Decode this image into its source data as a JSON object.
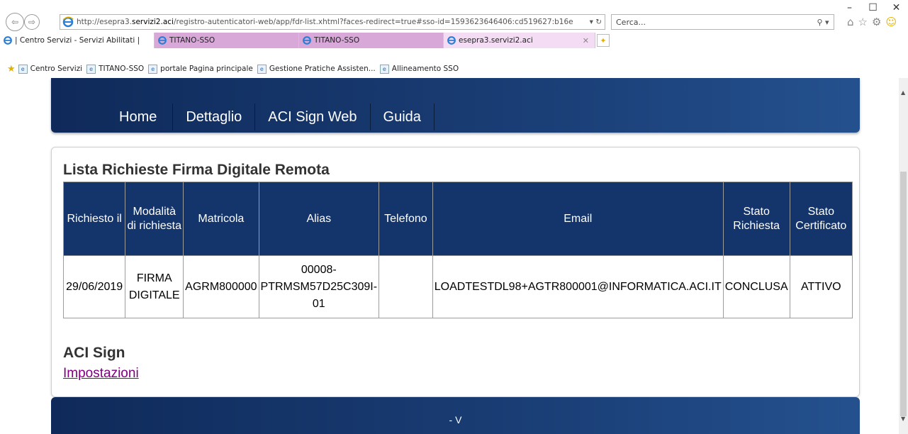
{
  "window": {
    "minimize_glyph": "–",
    "maximize_glyph": "☐",
    "close_glyph": "✕"
  },
  "browser": {
    "url_prefix": "http://esepra3.",
    "url_domain": "servizi2.aci",
    "url_rest": "/registro-autenticatori-web/app/fdr-list.xhtml?faces-redirect=true#sso-id=1593623646406:cd519627:b16e",
    "url_tools": "▾ ↻",
    "search_placeholder": "Cerca...",
    "search_glyph": "⚲ ▾",
    "tabs": [
      {
        "label": "| Centro Servizi - Servizi Abilitati |"
      },
      {
        "label": "TITANO-SSO"
      },
      {
        "label": "TITANO-SSO"
      },
      {
        "label": "esepra3.servizi2.aci",
        "close": "✕"
      }
    ],
    "favorites": [
      {
        "label": "Centro Servizi"
      },
      {
        "label": "TITANO-SSO"
      },
      {
        "label": "portale Pagina principale"
      },
      {
        "label": "Gestione Pratiche Assisten..."
      },
      {
        "label": "Allineamento SSO"
      }
    ]
  },
  "nav": {
    "items": [
      "Home",
      "Dettaglio",
      "ACI Sign Web",
      "Guida"
    ]
  },
  "list": {
    "title": "Lista Richieste Firma Digitale Remota",
    "columns": [
      "Richiesto il",
      "Modalità di richiesta",
      "Matricola",
      "Alias",
      "Telefono",
      "Email",
      "Stato Richiesta",
      "Stato Certificato"
    ],
    "rows": [
      {
        "richiesto_il": "29/06/2019",
        "modalita": "FIRMA DIGITALE",
        "matricola": "AGRM800000",
        "alias": "00008-PTRMSM57D25C309I-01",
        "telefono": "",
        "email": "LOADTESTDL98+AGTR800001@INFORMATICA.ACI.IT",
        "stato_richiesta": "CONCLUSA",
        "stato_certificato": "ATTIVO"
      }
    ]
  },
  "sign": {
    "title": "ACI Sign",
    "link": "Impostazioni"
  },
  "footer": {
    "version": "- V"
  },
  "colors": {
    "header_blue": "#14356b",
    "visited_link": "#800080"
  }
}
